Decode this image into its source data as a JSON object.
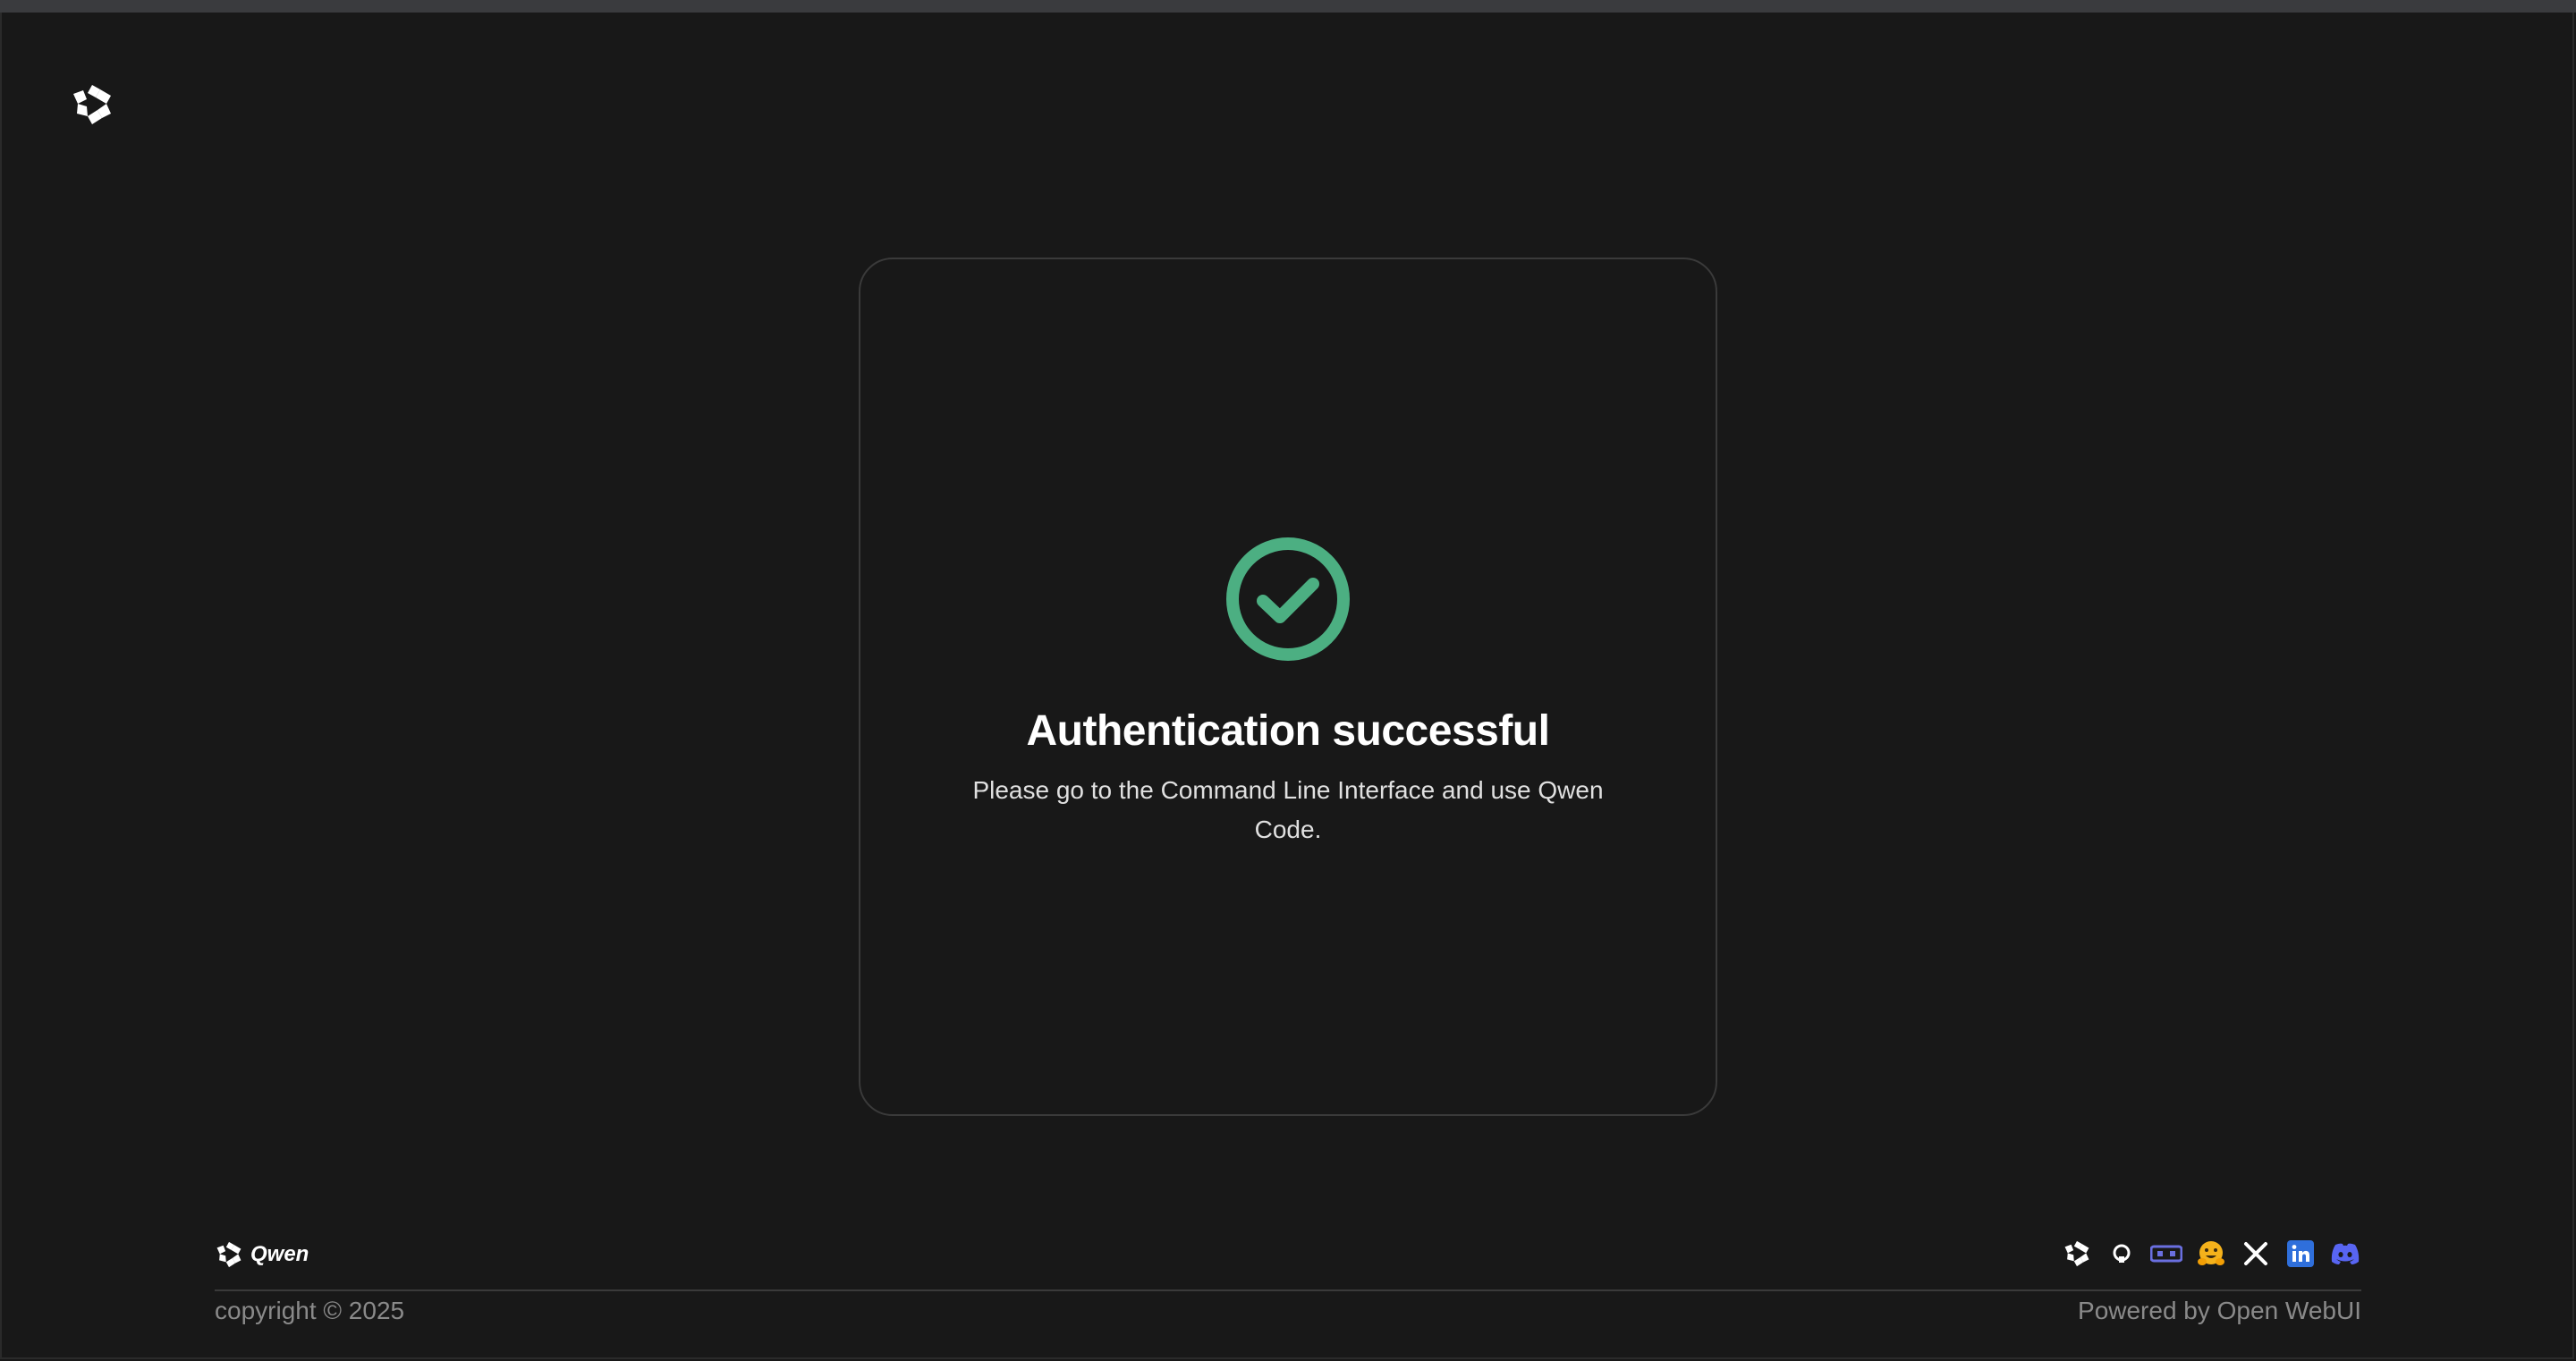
{
  "card": {
    "title": "Authentication successful",
    "message": "Please go to the Command Line Interface and use Qwen Code."
  },
  "footer": {
    "brand_text": "Qwen",
    "copyright": "copyright © 2025",
    "powered_by": "Powered by Open WebUI",
    "social_icons": [
      "qwen-icon",
      "github-icon",
      "modelscope-icon",
      "huggingface-icon",
      "x-icon",
      "linkedin-icon",
      "discord-icon"
    ]
  },
  "colors": {
    "background": "#181818",
    "success": "#4caf82",
    "card_border": "#3a3a3a",
    "muted_text": "#8a8a8a",
    "linkedin": "#2f6fdb",
    "discord": "#5865f2",
    "huggingface": "#f5b21b"
  }
}
